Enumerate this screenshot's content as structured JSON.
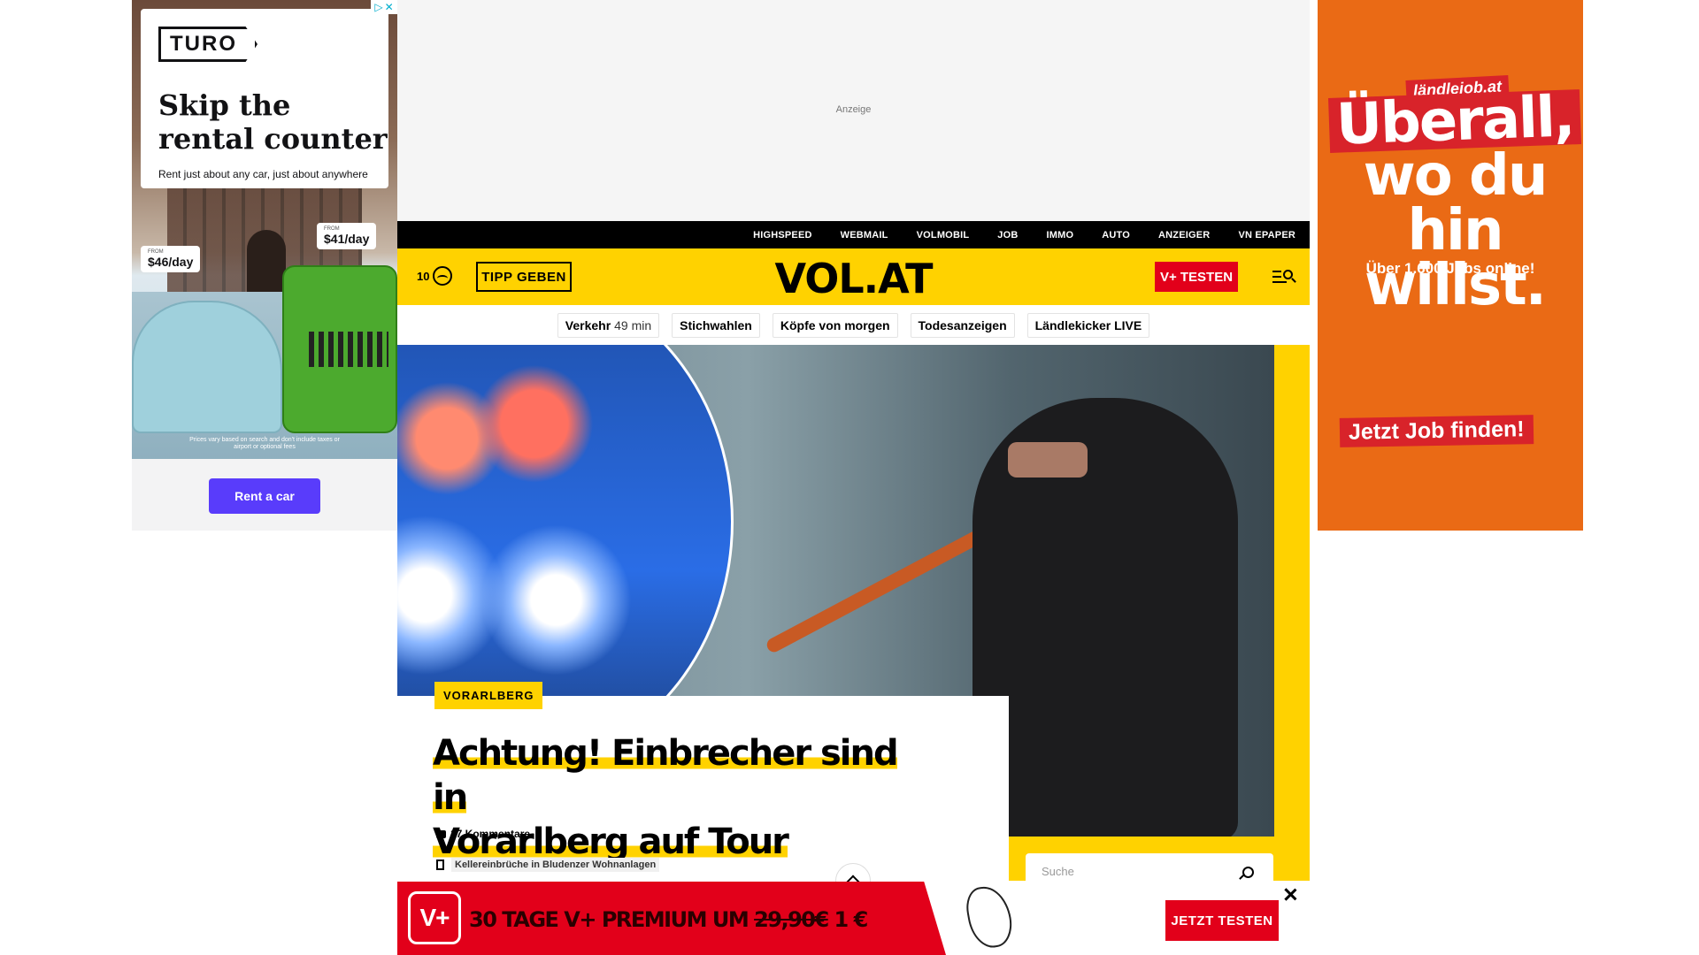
{
  "left_ad": {
    "brand": "TURO",
    "headline": "Skip the rental counter",
    "subtext": "Rent just about any car, just about anywhere",
    "price_from_label": "FROM",
    "price_left": "$46/day",
    "price_right": "$41/day",
    "disclaimer": "Prices vary based on search and don't include taxes or airport or optional fees",
    "cta": "Rent a car",
    "cta_color": "#593cfb",
    "adchoices_icon": "adchoices-icon",
    "close_icon": "close-icon"
  },
  "right_ad": {
    "brand": "ländlejob.at",
    "headline_line1": "Überall,",
    "headline_line2": "wo du hin",
    "headline_line3": "willst.",
    "jobs": "Über 1.600 Jobs online!",
    "cta": "Jetzt Job finden!",
    "background": "#ea6a15",
    "accent": "#d8232a"
  },
  "top_ad": {
    "label": "Anzeige"
  },
  "topnav": {
    "links": [
      "HIGHSPEED",
      "WEBMAIL",
      "VOLMOBIL",
      "JOB",
      "IMMO",
      "AUTO",
      "ANZEIGER",
      "VN EPAPER"
    ]
  },
  "header": {
    "temperature": "10",
    "weather_icon": "partly-cloudy-icon",
    "tipp_button": "TIPP GEBEN",
    "logo": "VOL.AT",
    "vplus_button": "V+ TESTEN",
    "menu_icon": "menu-search-icon",
    "brand_yellow": "#ffd200",
    "brand_red": "#e2001a"
  },
  "subnav": {
    "items": [
      {
        "label": "Verkehr",
        "extra": "49 min"
      },
      {
        "label": "Stichwahlen"
      },
      {
        "label": "Köpfe von morgen"
      },
      {
        "label": "Todesanzeigen"
      },
      {
        "label": "Ländlekicker LIVE"
      }
    ]
  },
  "article": {
    "tag": "VORARLBERG",
    "title_line1": "Achtung! Einbrecher sind in",
    "title_line2": "Vorarlberg auf Tour",
    "comments": "17 Kommentare",
    "related": "Kellereinbrüche in Bludenzer Wohnanlagen"
  },
  "search": {
    "placeholder": "Suche"
  },
  "promo": {
    "badge": "V+",
    "text_main": "30 TAGE V+ PREMIUM UM ",
    "old_price": "29,90€",
    "new_price": " 1 €",
    "cta": "JETZT TESTEN"
  }
}
